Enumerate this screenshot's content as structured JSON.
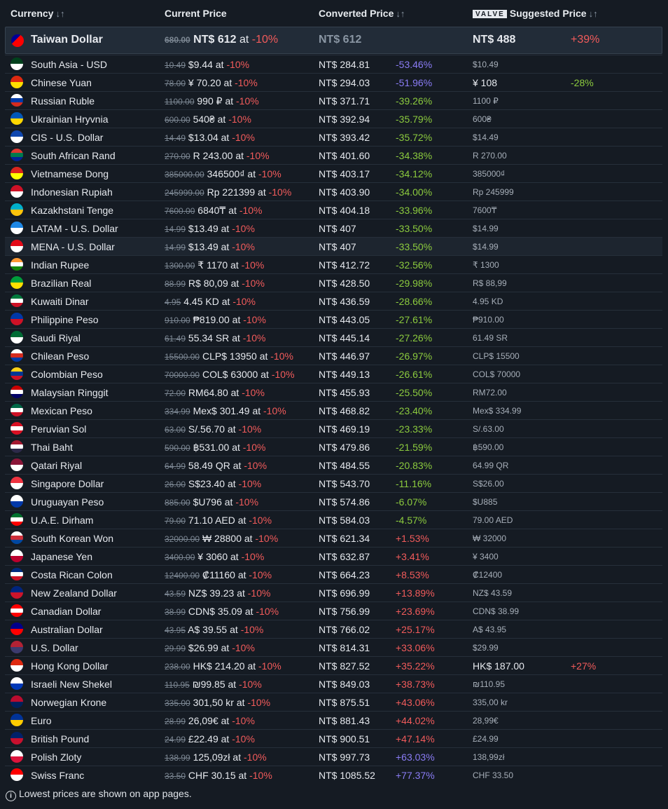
{
  "header": {
    "currency": "Currency",
    "current_price": "Current Price",
    "converted_price": "Converted Price",
    "valve_logo": "VALVE",
    "suggested_price": "Suggested Price",
    "sort_glyph": "↓↑"
  },
  "highlight": {
    "name": "Taiwan Dollar",
    "original": "680.00",
    "current": "NT$ 612",
    "at": "at",
    "discount": "-10%",
    "converted": "NT$ 612",
    "suggested": "NT$ 488",
    "suggested_pct": "+39%",
    "flag_colors": [
      "#fe0000",
      "#000095"
    ]
  },
  "rows": [
    {
      "name": "South Asia - USD",
      "orig": "10.49",
      "cur": "$9.44",
      "conv": "NT$ 284.81",
      "pct": "-53.46%",
      "sug": "$10.49",
      "sugpct": "",
      "flag": [
        "#01411c",
        "#ffffff"
      ]
    },
    {
      "name": "Chinese Yuan",
      "orig": "78.00",
      "cur": "¥ 70.20",
      "conv": "NT$ 294.03",
      "pct": "-51.96%",
      "sug": "¥ 108",
      "sugpct": "-28%",
      "flag": [
        "#de2910",
        "#ffde00"
      ]
    },
    {
      "name": "Russian Ruble",
      "orig": "1100.00",
      "cur": "990 ₽",
      "conv": "NT$ 371.71",
      "pct": "-39.26%",
      "sug": "1100 ₽",
      "sugpct": "",
      "flag": [
        "#ffffff",
        "#0039a6",
        "#d52b1e"
      ]
    },
    {
      "name": "Ukrainian Hryvnia",
      "orig": "600.00",
      "cur": "540₴",
      "conv": "NT$ 392.94",
      "pct": "-35.79%",
      "sug": "600₴",
      "sugpct": "",
      "flag": [
        "#0057b7",
        "#ffd700"
      ]
    },
    {
      "name": "CIS - U.S. Dollar",
      "orig": "14.49",
      "cur": "$13.04",
      "conv": "NT$ 393.42",
      "pct": "-35.72%",
      "sug": "$14.49",
      "sugpct": "",
      "flag": [
        "#0f47af",
        "#ffffff"
      ]
    },
    {
      "name": "South African Rand",
      "orig": "270.00",
      "cur": "R 243.00",
      "conv": "NT$ 401.60",
      "pct": "-34.38%",
      "sug": "R 270.00",
      "sugpct": "",
      "flag": [
        "#de3831",
        "#007a4d",
        "#002395"
      ]
    },
    {
      "name": "Vietnamese Dong",
      "orig": "385000.00",
      "cur": "346500₫",
      "conv": "NT$ 403.17",
      "pct": "-34.12%",
      "sug": "385000₫",
      "sugpct": "",
      "flag": [
        "#da251d",
        "#ffff00"
      ]
    },
    {
      "name": "Indonesian Rupiah",
      "orig": "245999.00",
      "cur": "Rp 221399",
      "conv": "NT$ 403.90",
      "pct": "-34.00%",
      "sug": "Rp 245999",
      "sugpct": "",
      "flag": [
        "#ce1126",
        "#ffffff"
      ]
    },
    {
      "name": "Kazakhstani Tenge",
      "orig": "7600.00",
      "cur": "6840₸",
      "conv": "NT$ 404.18",
      "pct": "-33.96%",
      "sug": "7600₸",
      "sugpct": "",
      "flag": [
        "#00afca",
        "#fec50c"
      ]
    },
    {
      "name": "LATAM - U.S. Dollar",
      "orig": "14.99",
      "cur": "$13.49",
      "conv": "NT$ 407",
      "pct": "-33.50%",
      "sug": "$14.99",
      "sugpct": "",
      "flag": [
        "#1e88e5",
        "#ffffff"
      ]
    },
    {
      "name": "MENA - U.S. Dollar",
      "orig": "14.99",
      "cur": "$13.49",
      "conv": "NT$ 407",
      "pct": "-33.50%",
      "sug": "$14.99",
      "sugpct": "",
      "flag": [
        "#e30a17",
        "#ffffff"
      ]
    },
    {
      "name": "Indian Rupee",
      "orig": "1300.00",
      "cur": "₹ 1170",
      "conv": "NT$ 412.72",
      "pct": "-32.56%",
      "sug": "₹ 1300",
      "sugpct": "",
      "flag": [
        "#ff9933",
        "#ffffff",
        "#138808"
      ]
    },
    {
      "name": "Brazilian Real",
      "orig": "88.99",
      "cur": "R$ 80,09",
      "conv": "NT$ 428.50",
      "pct": "-29.98%",
      "sug": "R$ 88,99",
      "sugpct": "",
      "flag": [
        "#009c3b",
        "#ffdf00"
      ]
    },
    {
      "name": "Kuwaiti Dinar",
      "orig": "4.95",
      "cur": "4.45 KD",
      "conv": "NT$ 436.59",
      "pct": "-28.66%",
      "sug": "4.95 KD",
      "sugpct": "",
      "flag": [
        "#007a3d",
        "#ffffff",
        "#ce1126"
      ]
    },
    {
      "name": "Philippine Peso",
      "orig": "910.00",
      "cur": "₱819.00",
      "conv": "NT$ 443.05",
      "pct": "-27.61%",
      "sug": "₱910.00",
      "sugpct": "",
      "flag": [
        "#0038a8",
        "#ce1126"
      ]
    },
    {
      "name": "Saudi Riyal",
      "orig": "61.49",
      "cur": "55.34 SR",
      "conv": "NT$ 445.14",
      "pct": "-27.26%",
      "sug": "61.49 SR",
      "sugpct": "",
      "flag": [
        "#006c35",
        "#ffffff"
      ]
    },
    {
      "name": "Chilean Peso",
      "orig": "15500.00",
      "cur": "CLP$ 13950",
      "conv": "NT$ 446.97",
      "pct": "-26.97%",
      "sug": "CLP$ 15500",
      "sugpct": "",
      "flag": [
        "#ffffff",
        "#d52b1e",
        "#0039a6"
      ]
    },
    {
      "name": "Colombian Peso",
      "orig": "70000.00",
      "cur": "COL$ 63000",
      "conv": "NT$ 449.13",
      "pct": "-26.61%",
      "sug": "COL$ 70000",
      "sugpct": "",
      "flag": [
        "#fcd116",
        "#003893",
        "#ce1126"
      ]
    },
    {
      "name": "Malaysian Ringgit",
      "orig": "72.00",
      "cur": "RM64.80",
      "conv": "NT$ 455.93",
      "pct": "-25.50%",
      "sug": "RM72.00",
      "sugpct": "",
      "flag": [
        "#cc0001",
        "#ffffff",
        "#010066"
      ]
    },
    {
      "name": "Mexican Peso",
      "orig": "334.99",
      "cur": "Mex$ 301.49",
      "conv": "NT$ 468.82",
      "pct": "-23.40%",
      "sug": "Mex$ 334.99",
      "sugpct": "",
      "flag": [
        "#006847",
        "#ffffff",
        "#ce1126"
      ]
    },
    {
      "name": "Peruvian Sol",
      "orig": "63.00",
      "cur": "S/.56.70",
      "conv": "NT$ 469.19",
      "pct": "-23.33%",
      "sug": "S/.63.00",
      "sugpct": "",
      "flag": [
        "#d91023",
        "#ffffff",
        "#d91023"
      ]
    },
    {
      "name": "Thai Baht",
      "orig": "590.00",
      "cur": "฿531.00",
      "conv": "NT$ 479.86",
      "pct": "-21.59%",
      "sug": "฿590.00",
      "sugpct": "",
      "flag": [
        "#a51931",
        "#ffffff",
        "#2d2a4a"
      ]
    },
    {
      "name": "Qatari Riyal",
      "orig": "64.99",
      "cur": "58.49 QR",
      "conv": "NT$ 484.55",
      "pct": "-20.83%",
      "sug": "64.99 QR",
      "sugpct": "",
      "flag": [
        "#8a1538",
        "#ffffff"
      ]
    },
    {
      "name": "Singapore Dollar",
      "orig": "26.00",
      "cur": "S$23.40",
      "conv": "NT$ 543.70",
      "pct": "-11.16%",
      "sug": "S$26.00",
      "sugpct": "",
      "flag": [
        "#ef3340",
        "#ffffff"
      ]
    },
    {
      "name": "Uruguayan Peso",
      "orig": "885.00",
      "cur": "$U796",
      "conv": "NT$ 574.86",
      "pct": "-6.07%",
      "sug": "$U885",
      "sugpct": "",
      "flag": [
        "#ffffff",
        "#0038a8"
      ]
    },
    {
      "name": "U.A.E. Dirham",
      "orig": "79.00",
      "cur": "71.10 AED",
      "conv": "NT$ 584.03",
      "pct": "-4.57%",
      "sug": "79.00 AED",
      "sugpct": "",
      "flag": [
        "#00732f",
        "#ffffff",
        "#ff0000"
      ]
    },
    {
      "name": "South Korean Won",
      "orig": "32000.00",
      "cur": "₩ 28800",
      "conv": "NT$ 621.34",
      "pct": "+1.53%",
      "sug": "₩ 32000",
      "sugpct": "",
      "flag": [
        "#ffffff",
        "#cd2e3a",
        "#0047a0"
      ]
    },
    {
      "name": "Japanese Yen",
      "orig": "3400.00",
      "cur": "¥ 3060",
      "conv": "NT$ 632.87",
      "pct": "+3.41%",
      "sug": "¥ 3400",
      "sugpct": "",
      "flag": [
        "#ffffff",
        "#bc002d"
      ]
    },
    {
      "name": "Costa Rican Colon",
      "orig": "12400.00",
      "cur": "₡11160",
      "conv": "NT$ 664.23",
      "pct": "+8.53%",
      "sug": "₡12400",
      "sugpct": "",
      "flag": [
        "#002b7f",
        "#ffffff",
        "#ce1126"
      ]
    },
    {
      "name": "New Zealand Dollar",
      "orig": "43.59",
      "cur": "NZ$ 39.23",
      "conv": "NT$ 696.99",
      "pct": "+13.89%",
      "sug": "NZ$ 43.59",
      "sugpct": "",
      "flag": [
        "#00247d",
        "#cc142b"
      ]
    },
    {
      "name": "Canadian Dollar",
      "orig": "38.99",
      "cur": "CDN$ 35.09",
      "conv": "NT$ 756.99",
      "pct": "+23.69%",
      "sug": "CDN$ 38.99",
      "sugpct": "",
      "flag": [
        "#ff0000",
        "#ffffff",
        "#ff0000"
      ]
    },
    {
      "name": "Australian Dollar",
      "orig": "43.95",
      "cur": "A$ 39.55",
      "conv": "NT$ 766.02",
      "pct": "+25.17%",
      "sug": "A$ 43.95",
      "sugpct": "",
      "flag": [
        "#00008b",
        "#ff0000"
      ]
    },
    {
      "name": "U.S. Dollar",
      "orig": "29.99",
      "cur": "$26.99",
      "conv": "NT$ 814.31",
      "pct": "+33.06%",
      "sug": "$29.99",
      "sugpct": "",
      "flag": [
        "#b22234",
        "#3c3b6e"
      ]
    },
    {
      "name": "Hong Kong Dollar",
      "orig": "238.00",
      "cur": "HK$ 214.20",
      "conv": "NT$ 827.52",
      "pct": "+35.22%",
      "sug": "HK$ 187.00",
      "sugpct": "+27%",
      "flag": [
        "#de2910",
        "#ffffff"
      ]
    },
    {
      "name": "Israeli New Shekel",
      "orig": "110.95",
      "cur": "₪99.85",
      "conv": "NT$ 849.03",
      "pct": "+38.73%",
      "sug": "₪110.95",
      "sugpct": "",
      "flag": [
        "#ffffff",
        "#0038b8"
      ]
    },
    {
      "name": "Norwegian Krone",
      "orig": "335.00",
      "cur": "301,50 kr",
      "conv": "NT$ 875.51",
      "pct": "+43.06%",
      "sug": "335,00 kr",
      "sugpct": "",
      "flag": [
        "#ba0c2f",
        "#00205b"
      ]
    },
    {
      "name": "Euro",
      "orig": "28.99",
      "cur": "26,09€",
      "conv": "NT$ 881.43",
      "pct": "+44.02%",
      "sug": "28,99€",
      "sugpct": "",
      "flag": [
        "#003399",
        "#ffcc00"
      ]
    },
    {
      "name": "British Pound",
      "orig": "24.99",
      "cur": "£22.49",
      "conv": "NT$ 900.51",
      "pct": "+47.14%",
      "sug": "£24.99",
      "sugpct": "",
      "flag": [
        "#012169",
        "#c8102e"
      ]
    },
    {
      "name": "Polish Zloty",
      "orig": "138.99",
      "cur": "125,09zł",
      "conv": "NT$ 997.73",
      "pct": "+63.03%",
      "sug": "138,99zł",
      "sugpct": "",
      "flag": [
        "#ffffff",
        "#dc143c"
      ]
    },
    {
      "name": "Swiss Franc",
      "orig": "33.50",
      "cur": "CHF 30.15",
      "conv": "NT$ 1085.52",
      "pct": "+77.37%",
      "sug": "CHF 33.50",
      "sugpct": "",
      "flag": [
        "#ff0000",
        "#ffffff"
      ]
    }
  ],
  "row_at": "at",
  "row_discount": "-10%",
  "footer": {
    "icon_glyph": "i",
    "text": "Lowest prices are shown on app pages."
  },
  "colors": {
    "background": "#151b23",
    "row_alt": "#1d252f",
    "red": "#f25b5b",
    "green": "#8ccb3e",
    "blue": "#8a7cf5"
  }
}
